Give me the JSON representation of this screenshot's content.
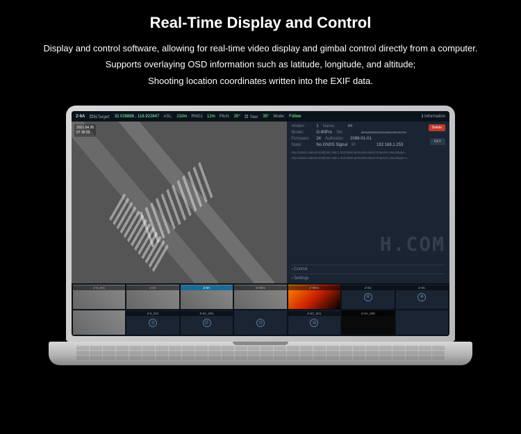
{
  "hero": {
    "title": "Real-Time Display and Control",
    "desc_line1": "Display and control software, allowing for real-time video display and gimbal control directly from a computer.",
    "desc_line2": "Supports overlaying OSD information such as latitude, longitude, and altitude;",
    "desc_line3": "Shooting location coordinates written into the EXIF data."
  },
  "topbar": {
    "device": "Z-9A",
    "target_label": "目标Target:",
    "target": "32.028886 , 118.922847",
    "asl_label": "ASL:",
    "asl": "210m",
    "rng_label": "RNG1",
    "rng": "12m",
    "pitch_label": "Pitch:",
    "pitch": "20°",
    "yaw_label": "目 Yaw:",
    "yaw": "35°",
    "mode_label": "Mode:",
    "mode": "Follow",
    "info_tab": "ℹ Information"
  },
  "osd": {
    "date": "2021 04 26",
    "time": "07 30 03"
  },
  "info": {
    "header": "Information",
    "field1_label": "#Index:",
    "field1_val": "1",
    "name_label": "Name:",
    "name_val": "##",
    "model_label": "Model:",
    "model_val": "G-80Pro",
    "sn_label": "SN:",
    "sn_val": "83002828200091406200305150709",
    "fw_label": "Firmware:",
    "fw_val": "24",
    "auth_label": "Authorize:",
    "auth_val": "2099-01-01",
    "state_label": "State:",
    "state_val": "No GNSS Signal",
    "ip_label": "IP:",
    "ip_val": "192.168.1.253",
    "url1": "rtsp://admin:admin123@192.168.1.253:556/cam/realmonitor?channel=1&subtype=",
    "url2": "rtsp://admin:admin123@192.168.1.253:556/cam/realmonitor?channel=1&subtype=1",
    "delete": "Delete",
    "key": "KEY",
    "section_control": "› Control",
    "section_settings": "› Settings"
  },
  "watermark": "H.COM",
  "thumbs": [
    {
      "label": "Z-6_001",
      "type": "street"
    },
    {
      "label": "Z-9A",
      "type": "street"
    },
    {
      "label": "Z-9A",
      "type": "street",
      "active": true
    },
    {
      "label": "Z-8801",
      "type": "street"
    },
    {
      "label": "Z-8801",
      "type": "thermal"
    },
    {
      "label": "Z-6C",
      "type": "icon",
      "icon": "⑥"
    },
    {
      "label": "Z-6C",
      "type": "icon",
      "icon": "⑧"
    },
    {
      "label": "",
      "type": "street"
    },
    {
      "label": "Z-6_012",
      "type": "icon",
      "icon": "⑪"
    },
    {
      "label": "Z-6C_001",
      "type": "icon",
      "icon": "⑫"
    },
    {
      "label": "",
      "type": "icon",
      "icon": "⑬"
    },
    {
      "label": "Z-6C_001",
      "type": "icon",
      "icon": "⑭"
    },
    {
      "label": "Z-9A_009",
      "type": "dark"
    },
    {
      "label": "",
      "type": "empty"
    }
  ]
}
